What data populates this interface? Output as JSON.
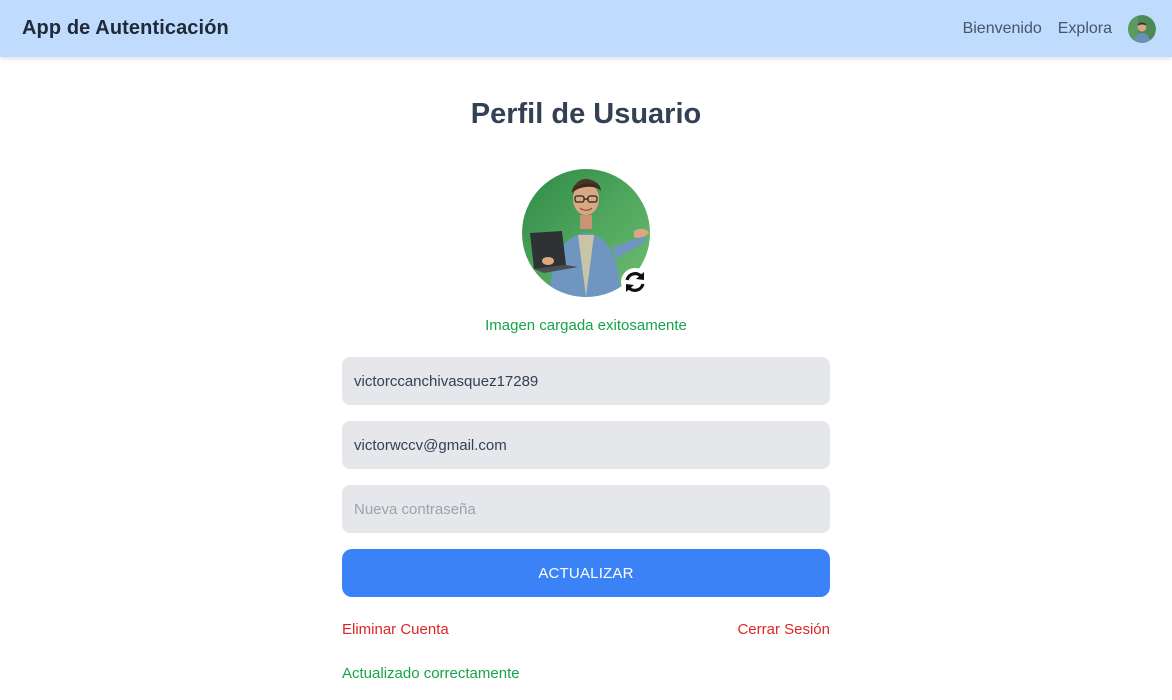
{
  "navbar": {
    "brand": "App de Autenticación",
    "links": [
      "Bienvenido",
      "Explora"
    ],
    "avatar_icon": "user-avatar-icon"
  },
  "profile": {
    "title": "Perfil de Usuario",
    "avatar_icon": "profile-photo",
    "refresh_icon": "refresh-icon",
    "upload_message": "Imagen cargada exitosamente"
  },
  "form": {
    "username_value": "victorccanchivasquez17289",
    "email_value": "victorwccv@gmail.com",
    "password_placeholder": "Nueva contraseña",
    "update_label": "ACTUALIZAR"
  },
  "actions": {
    "delete_label": "Eliminar Cuenta",
    "logout_label": "Cerrar Sesión",
    "success_message": "Actualizado correctamente"
  },
  "colors": {
    "navbar_bg": "#bfdbfe",
    "primary": "#3b82f6",
    "danger": "#dc2626",
    "success": "#16a34a",
    "input_bg": "#e5e7eb"
  }
}
